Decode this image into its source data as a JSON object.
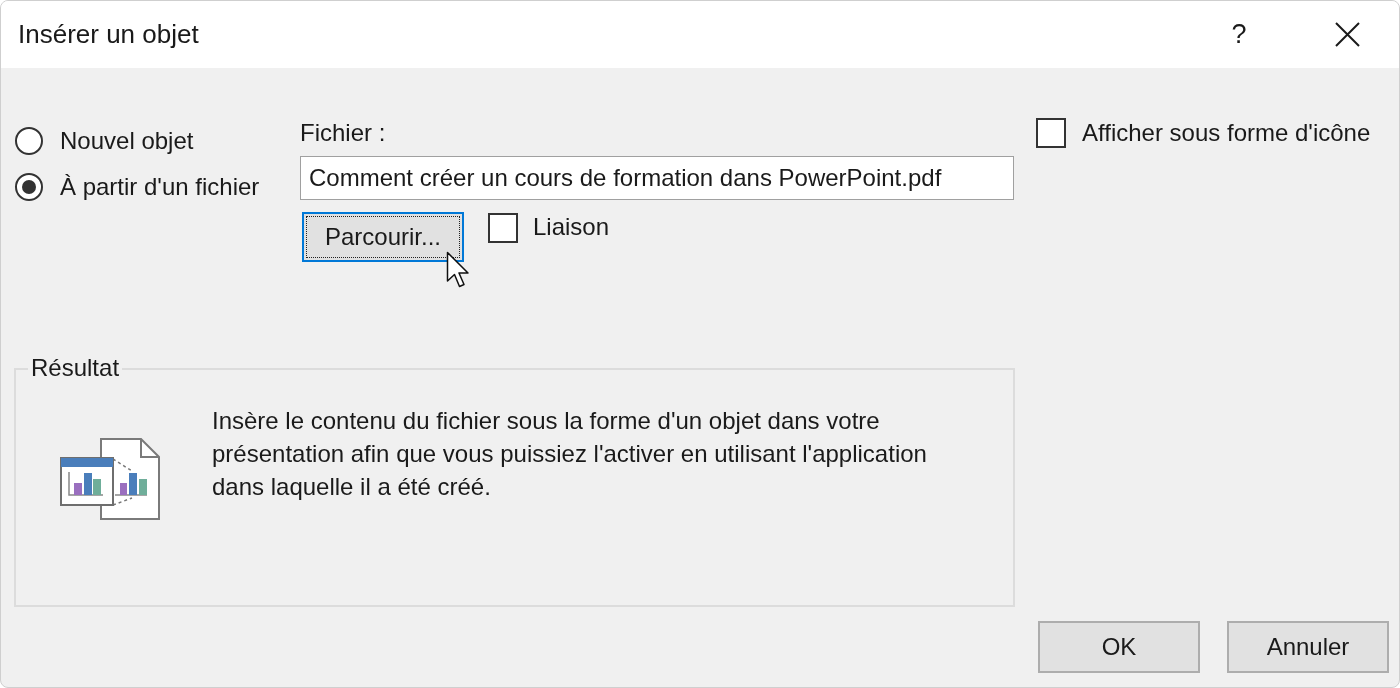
{
  "window": {
    "title": "Insérer un objet",
    "help_button": {
      "label": "?"
    }
  },
  "source_options": [
    {
      "label": "Nouvel objet",
      "selected": false
    },
    {
      "label": "À partir d'un fichier",
      "selected": true
    }
  ],
  "file": {
    "label": "Fichier :",
    "value": "Comment créer un cours de formation dans PowerPoint.pdf",
    "browse_button": {
      "label": "Parcourir...",
      "focused": true
    },
    "link_checkbox": {
      "label": "Liaison",
      "checked": false
    }
  },
  "display_as_icon": {
    "label": "Afficher sous forme d'icône",
    "checked": false
  },
  "result": {
    "title": "Résultat",
    "text": "Insère le contenu du fichier sous la forme d'un objet dans votre présentation afin que vous puissiez l'activer en utilisant l'application dans laquelle il a été créé."
  },
  "buttons": [
    {
      "label": "OK"
    },
    {
      "label": "Annuler"
    }
  ]
}
